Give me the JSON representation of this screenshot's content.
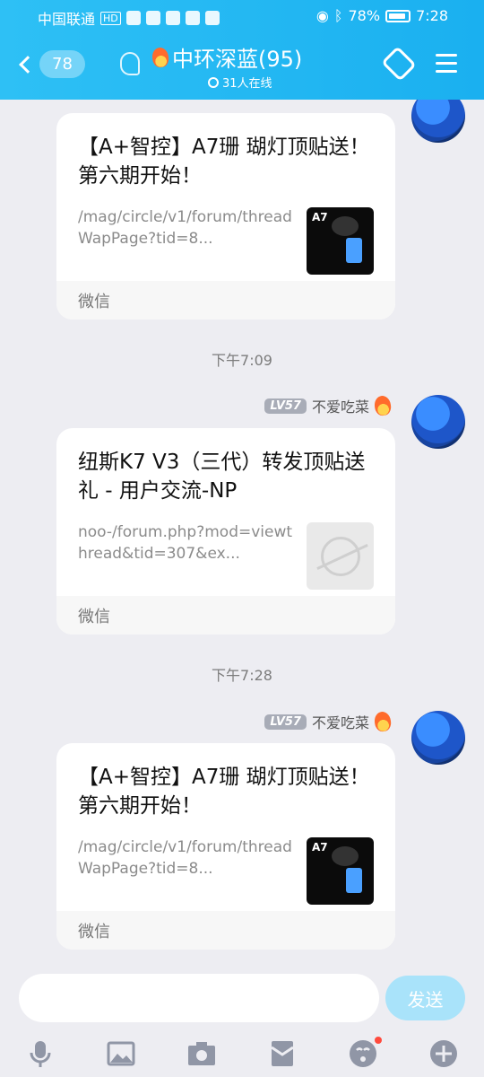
{
  "status_bar": {
    "carrier": "中国联通",
    "network": "HD",
    "battery": "78%",
    "time": "7:28"
  },
  "header": {
    "unread_count": "78",
    "group_title": "中环深蓝(95)",
    "online_text": "31人在线"
  },
  "messages": [
    {
      "title": "【A+智控】A7珊 瑚灯顶贴送！第六期开始！",
      "link": "/mag/circle/v1/forum/threadWapPage?tid=8...",
      "source": "微信",
      "thumb_label": "A7"
    },
    {
      "timestamp": "下午7:09",
      "sender": "不爱吃菜",
      "level": "LV57",
      "title": "纽斯K7 V3（三代）转发顶贴送礼 - 用户交流-NP",
      "link": "noo-/forum.php?mod=viewthread&tid=307&ex...",
      "source": "微信"
    },
    {
      "timestamp": "下午7:28",
      "sender": "不爱吃菜",
      "level": "LV57",
      "title": "【A+智控】A7珊 瑚灯顶贴送！第六期开始！",
      "link": "/mag/circle/v1/forum/threadWapPage?tid=8...",
      "source": "微信",
      "thumb_label": "A7"
    }
  ],
  "input": {
    "placeholder": "",
    "send_label": "发送"
  },
  "toolbar": {
    "icons": [
      "microphone-icon",
      "image-icon",
      "camera-icon",
      "red-packet-icon",
      "emoji-icon",
      "plus-icon"
    ]
  },
  "colors": {
    "header": "#1AB0F0",
    "send_disabled": "#A9E3FA",
    "background": "#EDEDF2"
  }
}
